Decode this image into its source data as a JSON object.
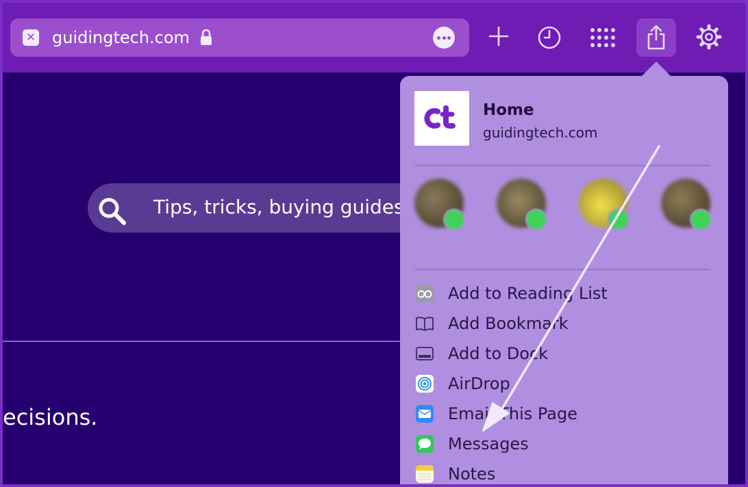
{
  "toolbar": {
    "url": "guidingtech.com"
  },
  "page": {
    "search_placeholder": "Tips, tricks, buying guides",
    "body_fragment": "ecisions."
  },
  "share_menu": {
    "site_title": "Home",
    "site_url": "guidingtech.com",
    "contacts": [
      {
        "name": "",
        "avatar_color": "#5c5340"
      },
      {
        "name": "",
        "avatar_color": "#6e6244"
      },
      {
        "name": "",
        "avatar_color": "#c8b23a"
      },
      {
        "name": "",
        "avatar_color": "#6b5a3c"
      }
    ],
    "items": [
      {
        "label": "Add to Reading List",
        "icon": "reading-list-icon"
      },
      {
        "label": "Add Bookmark",
        "icon": "bookmark-icon"
      },
      {
        "label": "Add to Dock",
        "icon": "dock-icon"
      },
      {
        "label": "AirDrop",
        "icon": "airdrop-icon"
      },
      {
        "label": "Email This Page",
        "icon": "mail-icon"
      },
      {
        "label": "Messages",
        "icon": "messages-icon"
      },
      {
        "label": "Notes",
        "icon": "notes-icon"
      }
    ]
  },
  "colors": {
    "toolbar_bg": "#6e1cb4",
    "page_bg": "#25006e",
    "popover_bg": "#b08fe0",
    "annotation_arrow": "#f2e8ff"
  }
}
